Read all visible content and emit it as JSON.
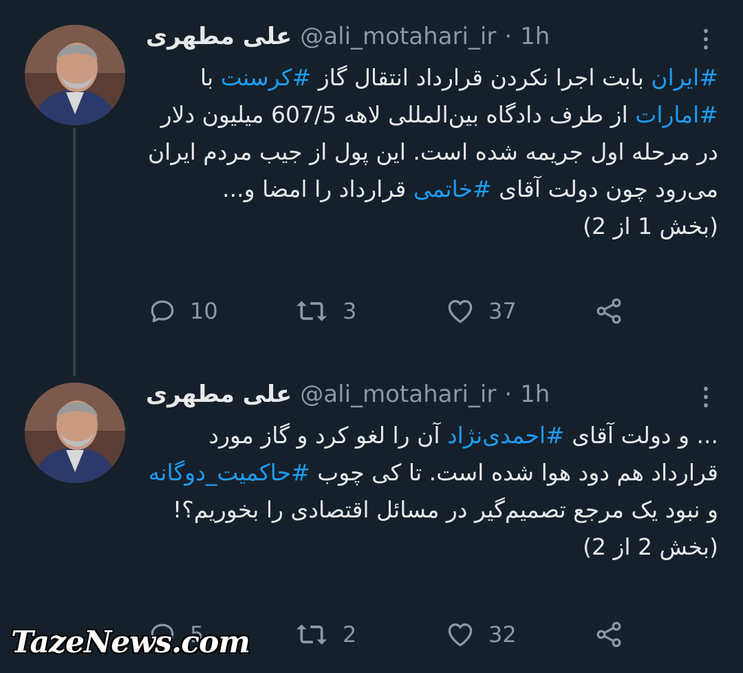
{
  "tweets": [
    {
      "author_name": "علی مطهری",
      "handle": "@ali_motahari_ir",
      "separator": "·",
      "time": "1h",
      "text": {
        "tag_iran": "#ایران",
        "t1": " بابت اجرا نکردن قرارداد انتقال گاز ",
        "tag_crescent": "#کرسنت",
        "t2": " با ",
        "tag_emirates": "#امارات",
        "t3": " از طرف دادگاه بین‌المللی لاهه 607/5 میلیون دلار در مرحله اول جریمه شده است. این پول از جیب مردم ایران می‌رود چون دولت آقای ",
        "tag_khatami": "#خاتمی",
        "t4": " قرارداد را امضا و...",
        "part": "(بخش 1 از 2)"
      },
      "stats": {
        "replies": "10",
        "retweets": "3",
        "likes": "37"
      }
    },
    {
      "author_name": "علی مطهری",
      "handle": "@ali_motahari_ir",
      "separator": "·",
      "time": "1h",
      "text": {
        "t1": "... و دولت آقای ",
        "tag_ahmadinejad": "#احمدی‌نژاد",
        "t2": " آن را لغو کرد و گاز مورد قرارداد هم دود هوا شده است. تا کی چوب ",
        "tag_dual": "#حاکمیت_دوگانه",
        "t3": " و نبود یک مرجع تصمیم‌گیر در مسائل اقتصادی را بخوریم؟!",
        "part": "(بخش 2 از 2)"
      },
      "stats": {
        "replies": "5",
        "retweets": "2",
        "likes": "32"
      }
    }
  ],
  "watermark": "TazeNews.com",
  "colors": {
    "background": "#15202b",
    "text": "#e7e9ea",
    "muted": "#8b98a5",
    "link": "#1d9bf0",
    "thread_line": "#38444d"
  },
  "icons": [
    "reply-icon",
    "retweet-icon",
    "like-icon",
    "share-icon",
    "more-icon"
  ]
}
